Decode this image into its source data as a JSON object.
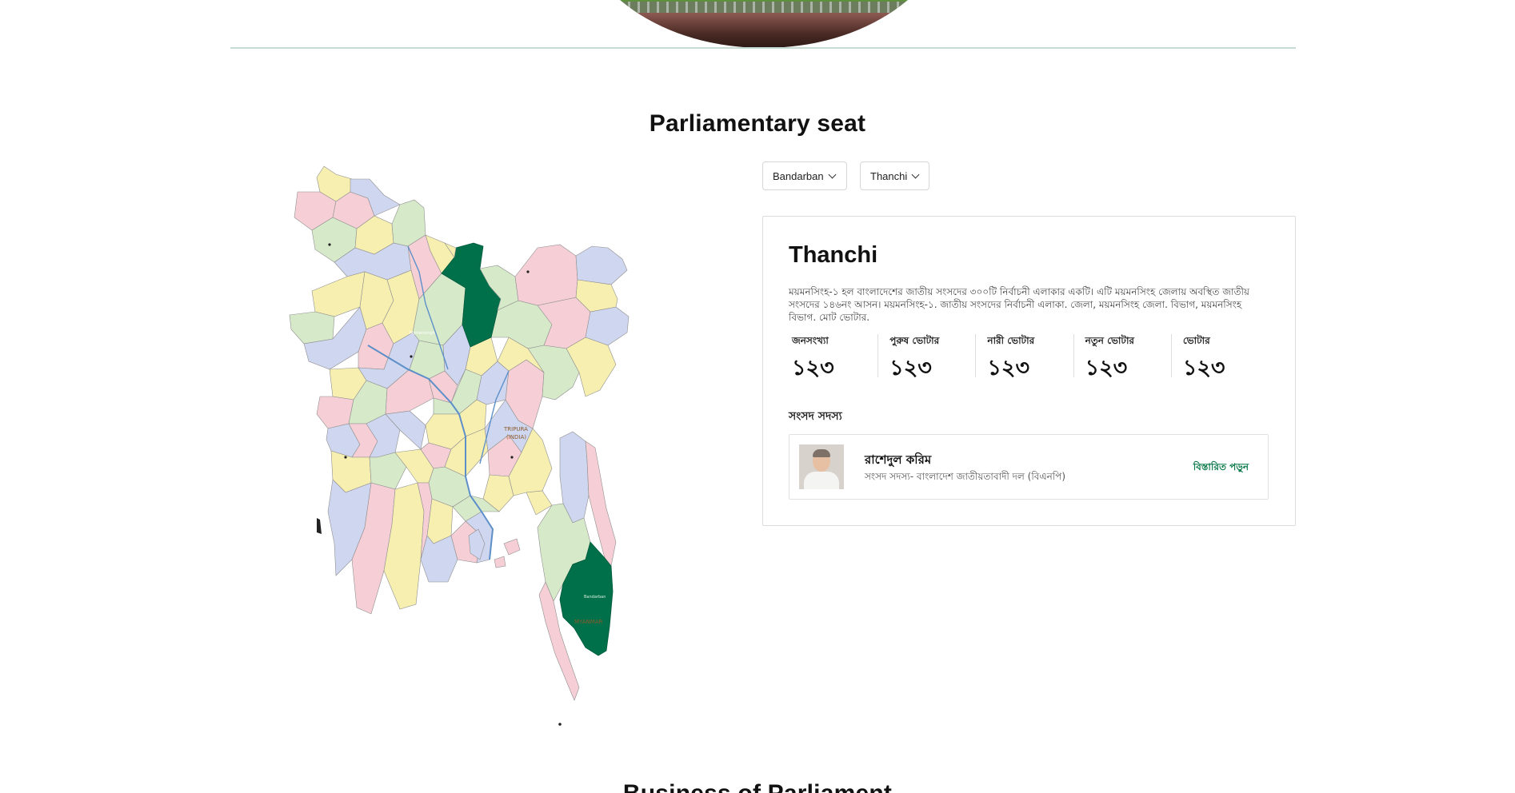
{
  "page": {
    "section_title": "Parliamentary seat",
    "next_section_title": "Business of Parliament"
  },
  "filters": {
    "district": "Bandarban",
    "upazila": "Thanchi"
  },
  "seat": {
    "name": "Thanchi",
    "description": "ময়মনসিংহ-১ হল বাংলাদেশের জাতীয় সংসদের ৩০০টি নির্বাচনী এলাকার একটি। এটি ময়মনসিংহ জেলায় অবস্থিত জাতীয় সংসদের ১৪৬নং আসন। ময়মনসিংহ-১. জাতীয় সংসদের নির্বাচনী এলাকা. জেলা, ময়মনসিংহ জেলা. বিভাগ, ময়মনসিংহ বিভাগ. মোট ভোটার.",
    "stats": [
      {
        "label": "জনসংখ্যা",
        "value": "১২৩"
      },
      {
        "label": "পুরুষ ভোটার",
        "value": "১২৩"
      },
      {
        "label": "নারী ভোটার",
        "value": "১২৩"
      },
      {
        "label": "নতুন ভোটার",
        "value": "১২৩"
      },
      {
        "label": "ভোটার",
        "value": "১২৩"
      }
    ],
    "mp_heading": "সংসদ সদস্য",
    "mp": {
      "name": "রাশেদুল করিম",
      "role": "সংসদ সদস্য- বাংলাদেশ জাতীয়তাবাদী দল (বিএনপি)",
      "link_label": "বিস্তারিত পড়ুন"
    }
  },
  "map": {
    "highlight_color": "#00704a",
    "labels": {
      "mymensingh": "Mymensingh",
      "bandarban": "Bandarban",
      "tripura": "TRIPURA",
      "tripura_sub": "(INDIA)",
      "myanmar": "MYANMAR"
    }
  }
}
